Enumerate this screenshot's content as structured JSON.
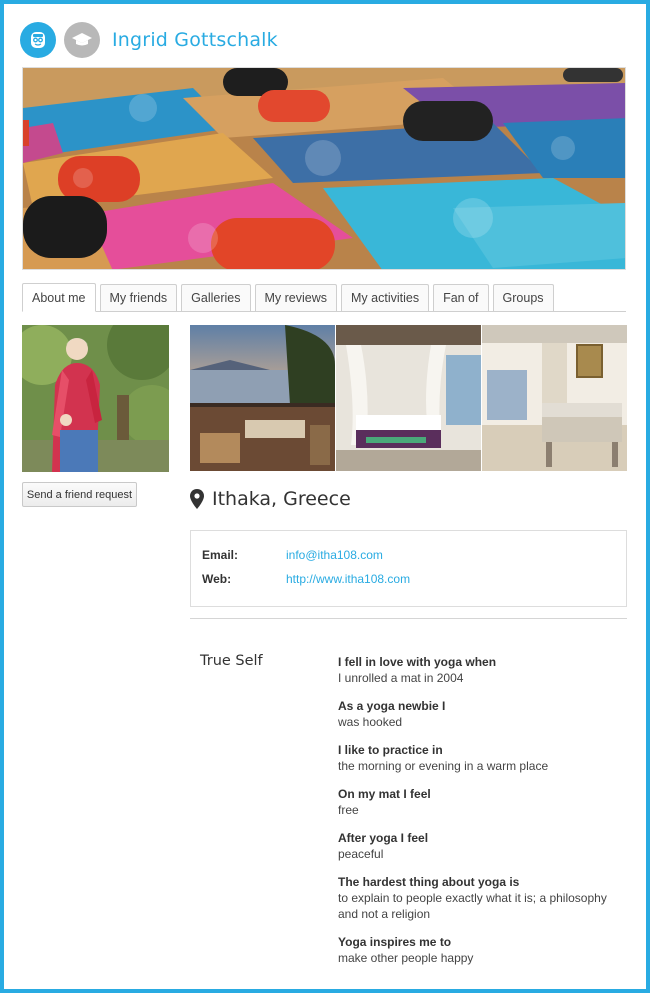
{
  "header": {
    "user_name": "Ingrid Gottschalk",
    "teacher_badge_icon": "teacher-face-icon",
    "grad_badge_icon": "graduation-cap-icon"
  },
  "tabs": [
    {
      "label": "About me",
      "active": true
    },
    {
      "label": "My friends"
    },
    {
      "label": "Galleries"
    },
    {
      "label": "My reviews"
    },
    {
      "label": "My activities"
    },
    {
      "label": "Fan of"
    },
    {
      "label": "Groups"
    }
  ],
  "sidebar": {
    "friend_button": "Send a friend request"
  },
  "location": {
    "icon": "map-pin-icon",
    "text": "Ithaka, Greece"
  },
  "contact": {
    "email_label": "Email:",
    "email_value": "info@itha108.com",
    "web_label": "Web:",
    "web_value": "http://www.itha108.com"
  },
  "true_self": {
    "title": "True Self",
    "items": [
      {
        "q": "I fell in love with yoga when",
        "a": "I unrolled a mat in 2004"
      },
      {
        "q": "As a yoga newbie I",
        "a": "was hooked"
      },
      {
        "q": "I like to practice in",
        "a": "the morning or evening in a warm place"
      },
      {
        "q": "On my mat I feel",
        "a": "free"
      },
      {
        "q": "After yoga I feel",
        "a": "peaceful"
      },
      {
        "q": "The hardest thing about yoga is",
        "a": "to explain to people exactly what it is; a philosophy and not a religion"
      },
      {
        "q": "Yoga inspires me to",
        "a": "make other people happy"
      }
    ]
  },
  "colors": {
    "accent": "#29abe2",
    "grad_badge": "#b8b8b8"
  }
}
